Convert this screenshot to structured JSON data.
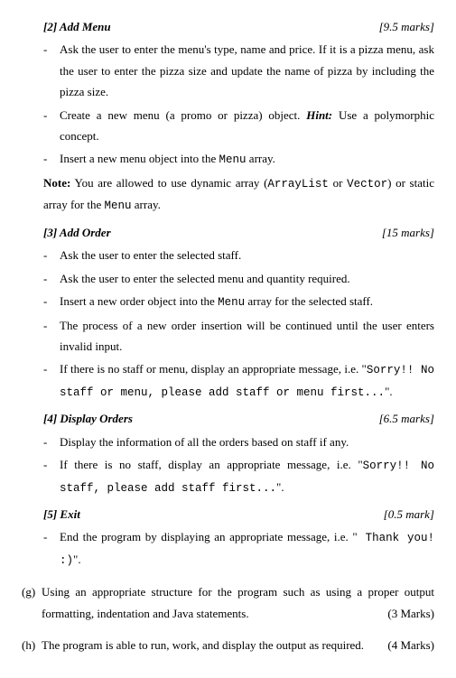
{
  "sections": [
    {
      "num": "[2]",
      "title": "Add Menu",
      "marks": "[9.5 marks]",
      "bullets": [
        {
          "parts": [
            {
              "t": "plain",
              "v": "Ask the user to enter the menu's type, name and price. If it is a pizza menu, ask the user to enter the pizza size and update the name of pizza by including the pizza size."
            }
          ]
        },
        {
          "parts": [
            {
              "t": "plain",
              "v": "Create a new menu (a promo or pizza) object. "
            },
            {
              "t": "hint",
              "v": "Hint:"
            },
            {
              "t": "plain",
              "v": " Use a polymorphic concept."
            }
          ]
        },
        {
          "parts": [
            {
              "t": "plain",
              "v": "Insert a new menu object into the "
            },
            {
              "t": "mono",
              "v": "Menu"
            },
            {
              "t": "plain",
              "v": " array."
            }
          ]
        }
      ],
      "note": {
        "label": "Note:",
        "parts": [
          {
            "t": "plain",
            "v": " You are allowed to use dynamic array ("
          },
          {
            "t": "mono",
            "v": "ArrayList"
          },
          {
            "t": "plain",
            "v": " or "
          },
          {
            "t": "mono",
            "v": "Vector"
          },
          {
            "t": "plain",
            "v": ") or static array for the "
          },
          {
            "t": "mono",
            "v": "Menu"
          },
          {
            "t": "plain",
            "v": " array."
          }
        ]
      }
    },
    {
      "num": "[3]",
      "title": "Add Order",
      "marks": "[15 marks]",
      "bullets": [
        {
          "parts": [
            {
              "t": "plain",
              "v": "Ask the user to enter the selected staff."
            }
          ]
        },
        {
          "parts": [
            {
              "t": "plain",
              "v": "Ask the user to enter the selected menu and quantity required."
            }
          ]
        },
        {
          "parts": [
            {
              "t": "plain",
              "v": "Insert a new order object into the "
            },
            {
              "t": "mono",
              "v": "Menu"
            },
            {
              "t": "plain",
              "v": " array for the selected staff."
            }
          ]
        },
        {
          "parts": [
            {
              "t": "plain",
              "v": "The process of a new order insertion will be continued until the user enters invalid input."
            }
          ]
        },
        {
          "parts": [
            {
              "t": "plain",
              "v": "If there is no staff or menu, display an appropriate message, i.e. \""
            },
            {
              "t": "mono",
              "v": "Sorry!! No staff or menu, please add staff or menu first..."
            },
            {
              "t": "plain",
              "v": "\"."
            }
          ]
        }
      ]
    },
    {
      "num": "[4]",
      "title": "Display Orders",
      "marks": "[6.5 marks]",
      "bullets": [
        {
          "parts": [
            {
              "t": "plain",
              "v": "Display the information of all the orders based on staff if any."
            }
          ]
        },
        {
          "parts": [
            {
              "t": "plain",
              "v": "If there is no staff, display an appropriate message, i.e. \""
            },
            {
              "t": "mono",
              "v": "Sorry!! No staff, please add staff first..."
            },
            {
              "t": "plain",
              "v": "\"."
            }
          ]
        }
      ]
    },
    {
      "num": "[5]",
      "title": "Exit",
      "marks": "[0.5 mark]",
      "bullets": [
        {
          "parts": [
            {
              "t": "plain",
              "v": "End the program by displaying an appropriate message, i.e. \""
            },
            {
              "t": "mono",
              "v": " Thank you! :)"
            },
            {
              "t": "plain",
              "v": "\"."
            }
          ]
        }
      ]
    }
  ],
  "outer": [
    {
      "label": "(g)",
      "text": "Using an appropriate structure for the program such as using a proper output formatting, indentation and Java statements.",
      "marks": "(3 Marks)"
    },
    {
      "label": "(h)",
      "text": "The program is able to run, work, and display the output as required.",
      "marks": "(4 Marks)"
    }
  ]
}
